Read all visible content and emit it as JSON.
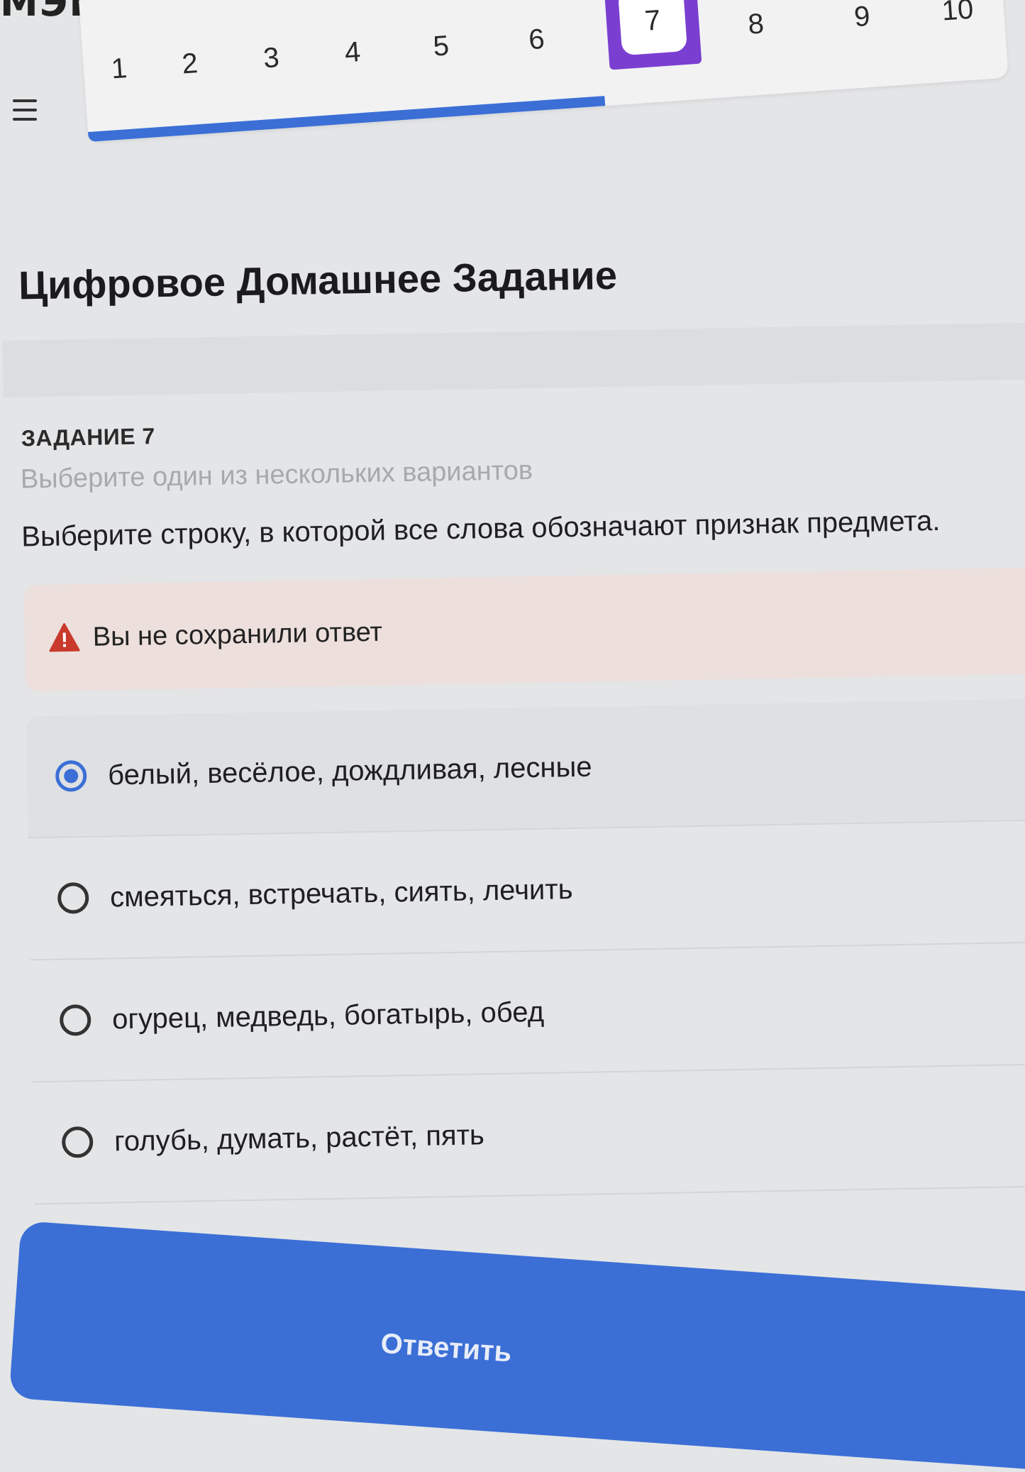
{
  "header": {
    "logo_text": "МЭШ",
    "menu_icon": "menu-icon"
  },
  "tabs": {
    "items": [
      "1",
      "2",
      "3",
      "4",
      "5",
      "6",
      "7",
      "8",
      "9",
      "10"
    ],
    "active": "7",
    "active_color": "#7a3fd0",
    "progress_color": "#3b6fd6"
  },
  "main": {
    "page_title": "Цифровое Домашнее Задание",
    "task_number": "ЗАДАНИЕ 7",
    "task_hint": "Выберите один из нескольких вариантов",
    "question": "Выберите строку, в которой все слова обозначают признак предмета.",
    "warning": {
      "icon": "warning-icon",
      "text": "Вы не сохранили ответ",
      "color": "#c93a2c"
    },
    "options": [
      {
        "label": "белый, весёлое, дождливая, лесные",
        "selected": true
      },
      {
        "label": "смеяться, встречать, сиять, лечить",
        "selected": false
      },
      {
        "label": "огурец, медведь, богатырь, обед",
        "selected": false
      },
      {
        "label": "голубь, думать, растёт, пять",
        "selected": false
      }
    ],
    "submit_label": "Ответить"
  }
}
